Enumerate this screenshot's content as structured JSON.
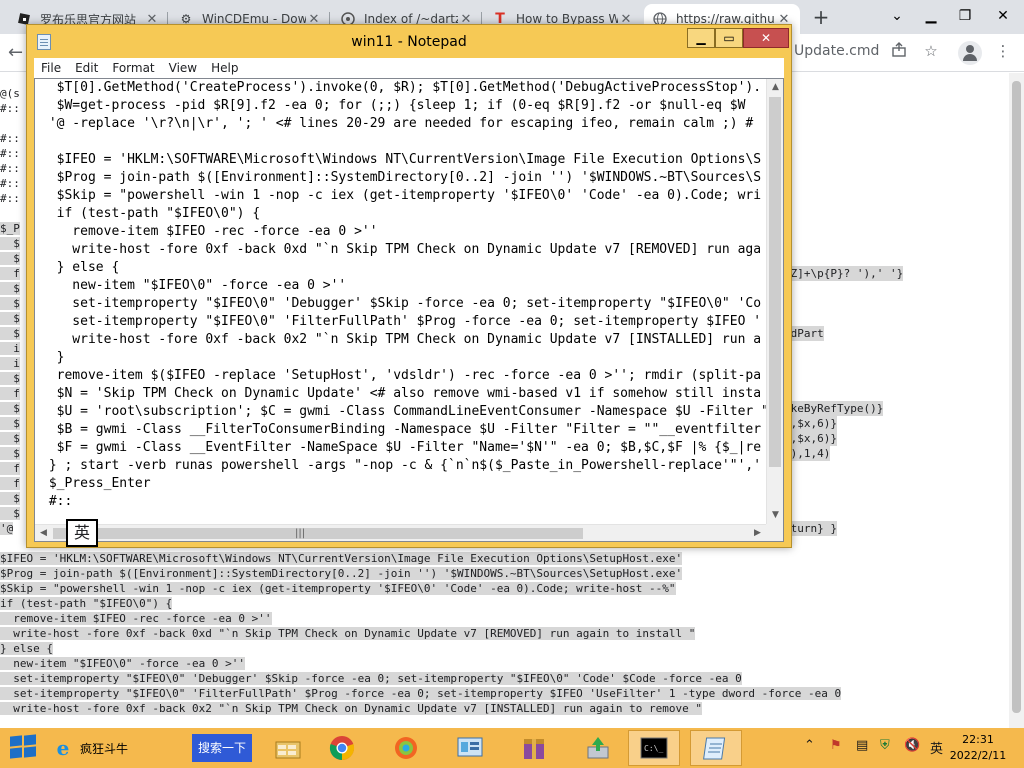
{
  "browser": {
    "tabs": [
      {
        "title": "罗布乐思官方网站",
        "icon": "roblox-icon"
      },
      {
        "title": "WinCDEmu - Dow",
        "icon": "gear-icon"
      },
      {
        "title": "Index of /~dartz/",
        "icon": "dartz-icon"
      },
      {
        "title": "How to Bypass W",
        "icon": "bypass-icon"
      },
      {
        "title": "https://raw.githu",
        "icon": "globe-icon"
      }
    ],
    "new_tab": "+",
    "address_tail": "Update.cmd"
  },
  "notepad": {
    "title": "win11 - Notepad",
    "menu": [
      "File",
      "Edit",
      "Format",
      "View",
      "Help"
    ],
    "lines": [
      "  $T[0].GetMethod('CreateProcess').invoke(0, $R); $T[0].GetMethod('DebugActiveProcessStop').",
      "  $W=get-process -pid $R[9].f2 -ea 0; for (;;) {sleep 1; if (0-eq $R[9].f2 -or $null-eq $W",
      " '@ -replace '\\r?\\n|\\r', '; ' <# lines 20-29 are needed for escaping ifeo, remain calm ;) #",
      "",
      "  $IFEO = 'HKLM:\\SOFTWARE\\Microsoft\\Windows NT\\CurrentVersion\\Image File Execution Options\\S",
      "  $Prog = join-path $([Environment]::SystemDirectory[0..2] -join '') '$WINDOWS.~BT\\Sources\\S",
      "  $Skip = \"powershell -win 1 -nop -c iex (get-itemproperty '$IFEO\\0' 'Code' -ea 0).Code; wri",
      "  if (test-path \"$IFEO\\0\") {",
      "    remove-item $IFEO -rec -force -ea 0 >''",
      "    write-host -fore 0xf -back 0xd \"`n Skip TPM Check on Dynamic Update v7 [REMOVED] run aga",
      "  } else {",
      "    new-item \"$IFEO\\0\" -force -ea 0 >''",
      "    set-itemproperty \"$IFEO\\0\" 'Debugger' $Skip -force -ea 0; set-itemproperty \"$IFEO\\0\" 'Co",
      "    set-itemproperty \"$IFEO\\0\" 'FilterFullPath' $Prog -force -ea 0; set-itemproperty $IFEO '",
      "    write-host -fore 0xf -back 0x2 \"`n Skip TPM Check on Dynamic Update v7 [INSTALLED] run a",
      "  }",
      "  remove-item $($IFEO -replace 'SetupHost', 'vdsldr') -rec -force -ea 0 >''; rmdir (split-pa",
      "  $N = 'Skip TPM Check on Dynamic Update' <# also remove wmi-based v1 if somehow still insta",
      "  $U = 'root\\subscription'; $C = gwmi -Class CommandLineEventConsumer -Namespace $U -Filter \"",
      "  $B = gwmi -Class __FilterToConsumerBinding -Namespace $U -Filter \"Filter = \"\"__eventfilter",
      "  $F = gwmi -Class __EventFilter -NameSpace $U -Filter \"Name='$N'\" -ea 0; $B,$C,$F |% {$_|re",
      " } ; start -verb runas powershell -args \"-nop -c & {`n`n$($_Paste_in_Powershell-replace'\"','",
      " $_Press_Enter",
      " #::"
    ],
    "ime": "英"
  },
  "background_lines": [
    {
      "left": "@(s",
      "hl": false
    },
    {
      "left": "#::",
      "hl": false
    },
    {
      "left": "",
      "hl": false
    },
    {
      "left": "#::",
      "hl": false
    },
    {
      "left": "#::",
      "hl": false
    },
    {
      "left": "#::",
      "hl": false
    },
    {
      "left": "#::",
      "hl": false
    },
    {
      "left": "#::",
      "hl": false
    },
    {
      "left": "",
      "hl": false
    },
    {
      "left": "$_P",
      "hl": true
    },
    {
      "left": "  $",
      "hl": true
    },
    {
      "left": "  $",
      "hl": true
    },
    {
      "left": "  f",
      "hl": true
    },
    {
      "left": "  $",
      "hl": true
    },
    {
      "left": "  $",
      "hl": true
    },
    {
      "left": "  $",
      "hl": true
    },
    {
      "left": "  $",
      "hl": true
    },
    {
      "left": "  i",
      "hl": true
    },
    {
      "left": "  i",
      "hl": true
    },
    {
      "left": "  $",
      "hl": true
    },
    {
      "left": "  f",
      "hl": true
    },
    {
      "left": "  $",
      "hl": true
    },
    {
      "left": "  $",
      "hl": true
    },
    {
      "left": "  $",
      "hl": true
    },
    {
      "left": "  $",
      "hl": true
    },
    {
      "left": "  f",
      "hl": true
    },
    {
      "left": "  f",
      "hl": true
    },
    {
      "left": "  $",
      "hl": true
    },
    {
      "left": "  $",
      "hl": true
    },
    {
      "left": "'@",
      "hl": true
    },
    {
      "left": "",
      "hl": false
    },
    {
      "left": "$IFEO = 'HKLM:\\SOFTWARE\\Microsoft\\Windows NT\\CurrentVersion\\Image File Execution Options\\SetupHost.exe'",
      "hl": true
    },
    {
      "left": "$Prog = join-path $([Environment]::SystemDirectory[0..2] -join '') '$WINDOWS.~BT\\Sources\\SetupHost.exe'",
      "hl": true
    },
    {
      "left": "$Skip = \"powershell -win 1 -nop -c iex (get-itemproperty '$IFEO\\0' 'Code' -ea 0).Code; write-host --%\"",
      "hl": true
    },
    {
      "left": "if (test-path \"$IFEO\\0\") {",
      "hl": true
    },
    {
      "left": "  remove-item $IFEO -rec -force -ea 0 >''",
      "hl": true
    },
    {
      "left": "  write-host -fore 0xf -back 0xd \"`n Skip TPM Check on Dynamic Update v7 [REMOVED] run again to install \"",
      "hl": true
    },
    {
      "left": "} else {",
      "hl": true
    },
    {
      "left": "  new-item \"$IFEO\\0\" -force -ea 0 >''",
      "hl": true
    },
    {
      "left": "  set-itemproperty \"$IFEO\\0\" 'Debugger' $Skip -force -ea 0; set-itemproperty \"$IFEO\\0\" 'Code' $Code -force -ea 0",
      "hl": true
    },
    {
      "left": "  set-itemproperty \"$IFEO\\0\" 'FilterFullPath' $Prog -force -ea 0; set-itemproperty $IFEO 'UseFilter' 1 -type dword -force -ea 0",
      "hl": true
    },
    {
      "left": "  write-host -fore 0xf -back 0x2 \"`n Skip TPM Check on Dynamic Update v7 [INSTALLED] run again to remove \"",
      "hl": true
    }
  ],
  "background_right_fragments": [
    "-Z]+\\p{P}? '),' '}",
    "ldPart",
    "akeByRefType()}",
    "+,$x,6)}",
    "+,$x,6)}",
    "]),1,4)",
    "}",
    "}",
    "eturn} }"
  ],
  "taskbar": {
    "ie_label": "疯狂斗牛",
    "search_label": "搜索一下",
    "apps": [
      {
        "name": "app-windows-explorer-icon"
      },
      {
        "name": "chrome-icon"
      },
      {
        "name": "app-swirl-icon"
      },
      {
        "name": "control-panel-icon"
      },
      {
        "name": "archive-icon"
      },
      {
        "name": "installer-icon"
      },
      {
        "name": "cmd-icon"
      },
      {
        "name": "notepad-icon"
      }
    ],
    "tray_lang": "英",
    "time": "22:31",
    "date": "2022/2/11"
  },
  "colors": {
    "notepad_frame": "#f6c955",
    "taskbar": "#f5b94d",
    "highlight": "#d7d7d7",
    "close_red": "#c75050"
  }
}
